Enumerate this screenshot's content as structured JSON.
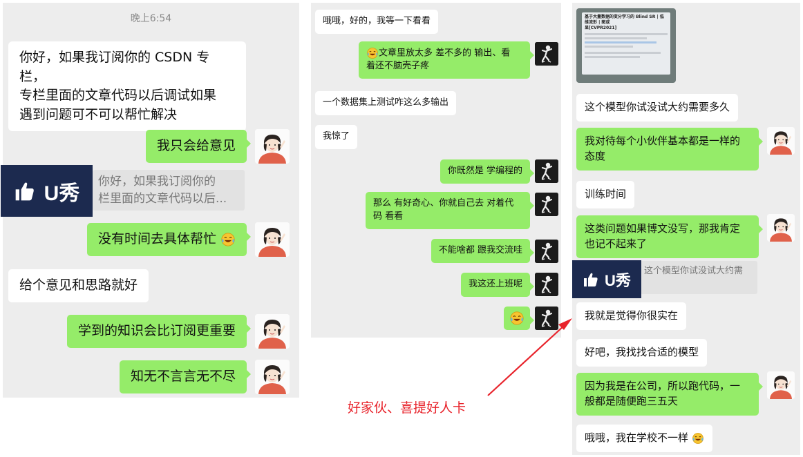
{
  "panel1": {
    "timestamp": "晚上6:54",
    "messages": [
      {
        "text1": "你好，如果我订阅你的 CSDN 专栏，",
        "text2": "专栏里面的文章代码以后调试如果",
        "text3": "遇到问题可不可以帮忙解决"
      },
      {
        "text": "我只会给意见"
      },
      {
        "quote1": "你好，如果我订阅你的",
        "quote2": "栏里面的文章代码以后..."
      },
      {
        "text": "没有时间去具体帮忙"
      },
      {
        "text": "给个意见和思路就好"
      },
      {
        "text": "学到的知识会比订阅更重要"
      },
      {
        "text": "知无不言言无不尽"
      }
    ]
  },
  "panel2": {
    "messages": [
      {
        "text": "哦哦，好的，我等一下看看"
      },
      {
        "text1": "文章里放太多 差不多的 输出、看",
        "text2": "着还不脑壳子疼"
      },
      {
        "text": "一个数据集上测试咋这么多输出"
      },
      {
        "text": "我惊了"
      },
      {
        "text": "你既然是 学编程的"
      },
      {
        "text1": "那么 有好奇心、你就自己去 对着代",
        "text2": "码 看看"
      },
      {
        "text": "不能啥都 跟我交流哇"
      },
      {
        "text": "我这还上班呢"
      }
    ]
  },
  "panel3": {
    "thumb_title1": "基于大量数据的变分学习的 Blind SR | 低维流形 | 图或",
    "thumb_title2": "显[CVPR2021]",
    "messages": [
      {
        "text": "这个模型你试没试大约需要多久"
      },
      {
        "text1": "我对待每个小伙伴基本都是一样的",
        "text2": "态度"
      },
      {
        "text": "训练时间"
      },
      {
        "text1": "这类问题如果博文没写，那我肯定",
        "text2": "也记不起来了"
      },
      {
        "quote": "这个模型你试没试大约需"
      },
      {
        "text": "我就是觉得你很实在"
      },
      {
        "text": "好吧，我找找合适的模型"
      },
      {
        "text1": "因为我是在公司，所以跑代码，一",
        "text2": "般都是随便跑三五天"
      },
      {
        "text": "哦哦，我在学校不一样"
      }
    ]
  },
  "badge": {
    "label": "U秀"
  },
  "annotation": {
    "text": "好家伙、喜提好人卡",
    "color": "#e8232b"
  },
  "colors": {
    "green_bubble": "#95ec69",
    "white_bubble": "#ffffff",
    "chat_bg": "#ededed",
    "badge_bg": "#1c2a4f"
  },
  "icons": {
    "like": "thumbs-up-icon",
    "laugh": "laughing-crying-emoji",
    "girl_avatar": "cartoon-girl-avatar",
    "dark_avatar": "dancing-figure-avatar"
  }
}
